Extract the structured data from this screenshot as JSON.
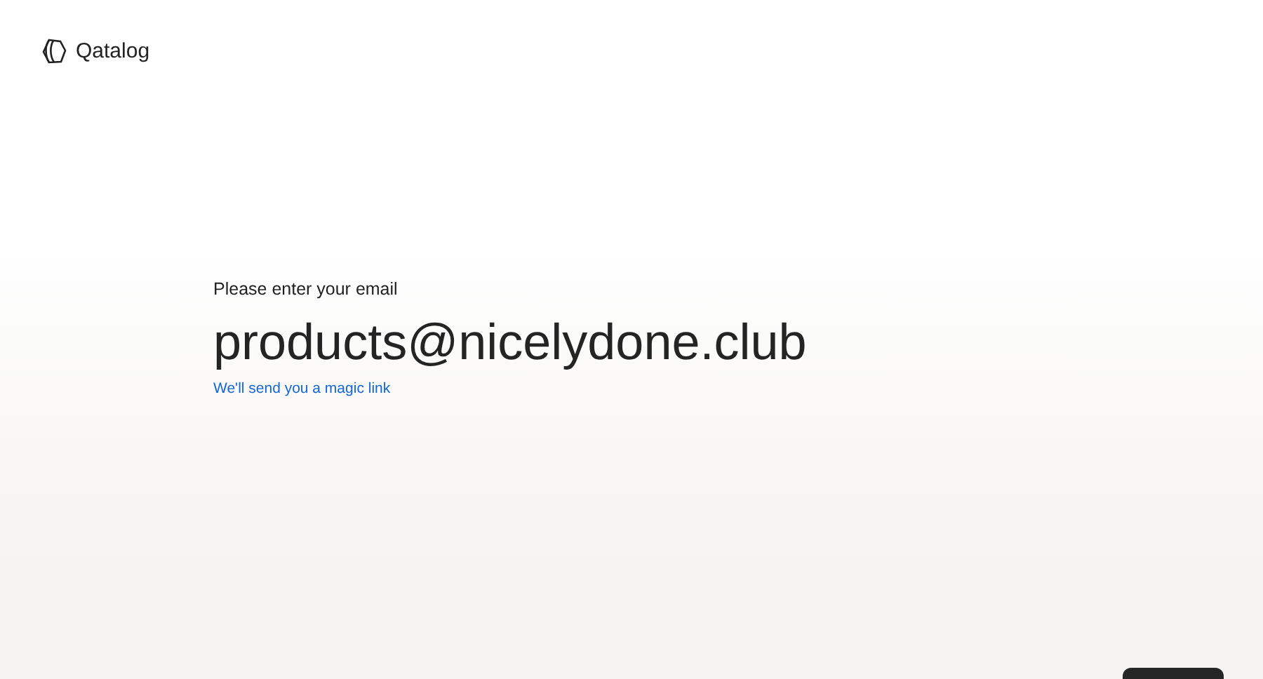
{
  "brand": {
    "name": "Qatalog"
  },
  "form": {
    "label": "Please enter your email",
    "email": {
      "value": "products@nicelydone.club"
    },
    "hint": "We'll send you a magic link"
  },
  "action_button": {
    "visible": true
  }
}
